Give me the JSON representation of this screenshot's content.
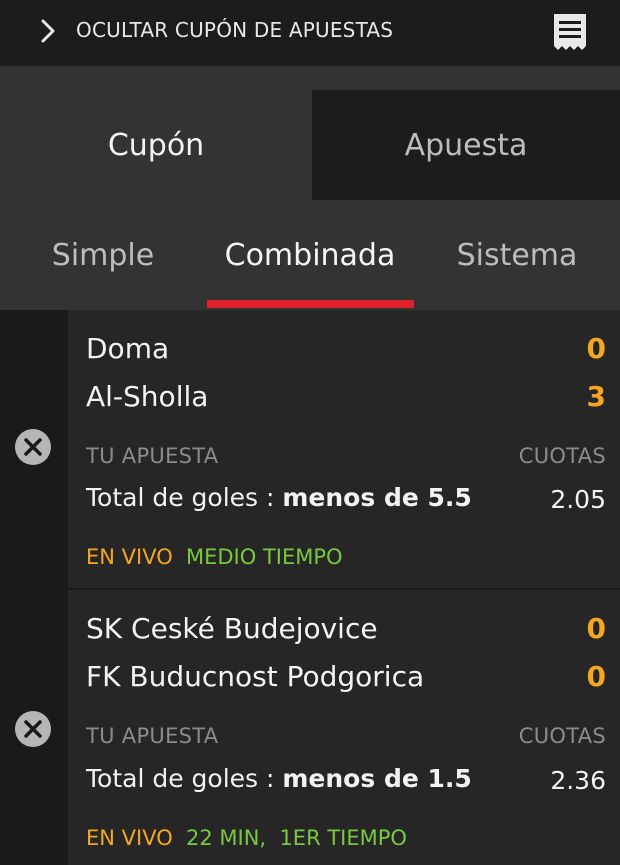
{
  "header": {
    "hide_label": "OCULTAR CUPÓN DE APUESTAS",
    "chevron_icon": "chevron-right-icon",
    "receipt_icon": "receipt-icon"
  },
  "tabs": [
    {
      "label": "Cupón",
      "active": true
    },
    {
      "label": "Apuesta",
      "active": false
    }
  ],
  "subtabs": [
    {
      "label": "Simple",
      "active": false
    },
    {
      "label": "Combinada",
      "active": true
    },
    {
      "label": "Sistema",
      "active": false
    }
  ],
  "bets": [
    {
      "home": "Doma",
      "home_score": "0",
      "away": "Al-Sholla",
      "away_score": "3",
      "your_bet_label": "TU APUESTA",
      "odds_label": "CUOTAS",
      "market": "Total de goles :",
      "selection": "menos de 5.5",
      "odds": "2.05",
      "live": "EN VIVO",
      "status": "MEDIO TIEMPO"
    },
    {
      "home": "SK Ceské Budejovice",
      "home_score": "0",
      "away": "FK Buducnost Podgorica",
      "away_score": "0",
      "your_bet_label": "TU APUESTA",
      "odds_label": "CUOTAS",
      "market": "Total de goles :",
      "selection": "menos de 1.5",
      "odds": "2.36",
      "live": "EN VIVO",
      "status": "22 MIN,  1ER TIEMPO"
    }
  ],
  "colors": {
    "accent_red": "#e0202a",
    "score_orange": "#f5a623",
    "status_green": "#79c93f"
  }
}
